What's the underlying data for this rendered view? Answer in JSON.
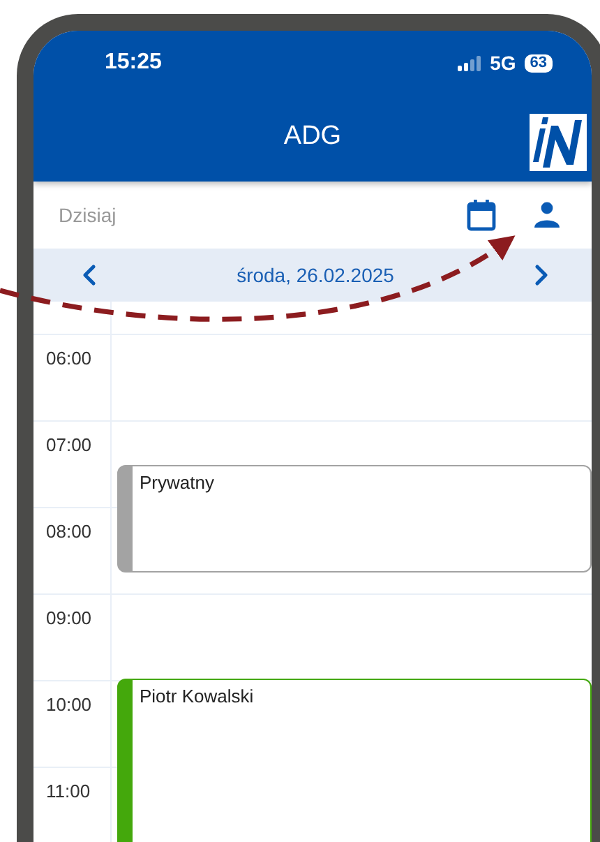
{
  "status_bar": {
    "time": "15:25",
    "network": "5G",
    "battery": "63"
  },
  "header": {
    "title": "ADG"
  },
  "toolbar": {
    "today_label": "Dzisiaj"
  },
  "date_bar": {
    "date": "środa, 26.02.2025"
  },
  "hours": [
    "06:00",
    "07:00",
    "08:00",
    "09:00",
    "10:00",
    "11:00"
  ],
  "events": [
    {
      "title": "Prywatny",
      "color": "#a3a3a3"
    },
    {
      "title": "Piotr Kowalski",
      "color": "#44a80c"
    }
  ]
}
